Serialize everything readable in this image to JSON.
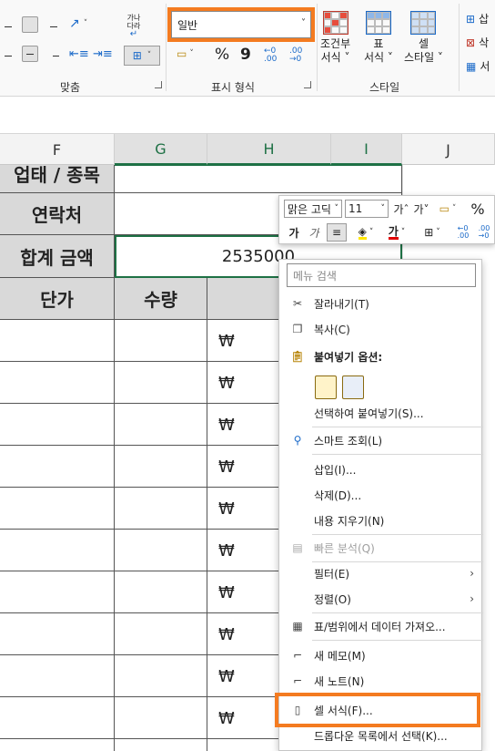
{
  "ribbon": {
    "wrap_text_label": "가나\n다라",
    "number_format": "일반",
    "groups": {
      "alignment": "맞춤",
      "number": "표시 형식",
      "styles": "스타일"
    },
    "percent": "%",
    "comma": "9",
    "inc_decimal": ".00→.0",
    "dec_decimal": ".00→.0",
    "styles_buttons": [
      {
        "line1": "조건부",
        "line2": "서식 ˅"
      },
      {
        "line1": "표",
        "line2": "서식 ˅"
      },
      {
        "line1": "셀",
        "line2": "스타일 ˅"
      }
    ],
    "cells_partial": [
      "삽",
      "삭",
      "서"
    ]
  },
  "columns": [
    "F",
    "G",
    "H",
    "I",
    "J"
  ],
  "sheet": {
    "row1_label": "업태 / 종목",
    "row2_label": "연락처",
    "row3_label": "합계 금액",
    "total_value": "2535000",
    "header_unit_price": "단가",
    "header_qty": "수량",
    "won_symbol": "₩"
  },
  "mini_toolbar": {
    "font_name": "맑은 고딕",
    "font_size": "11",
    "grow_font": "가ˆ",
    "shrink_font": "가˅",
    "percent": "%",
    "bold": "가",
    "italic": "가",
    "font_color_glyph": "가"
  },
  "context_menu": {
    "search_placeholder": "메뉴 검색",
    "items": {
      "cut": "잘라내기(T)",
      "copy": "복사(C)",
      "paste_options": "붙여넣기 옵션:",
      "paste_special": "선택하여 붙여넣기(S)...",
      "smart_lookup": "스마트 조회(L)",
      "insert": "삽입(I)...",
      "delete": "삭제(D)...",
      "clear_contents": "내용 지우기(N)",
      "quick_analysis": "빠른 분석(Q)",
      "filter": "필터(E)",
      "sort": "정렬(O)",
      "get_data": "표/범위에서 데이터 가져오...",
      "new_comment": "새 메모(M)",
      "new_note": "새 노트(N)",
      "format_cells": "셀 서식(F)...",
      "pick_list": "드롭다운 목록에서 선택(K)..."
    }
  },
  "colors": {
    "highlight": "#f47b20",
    "selection_green": "#1e7145",
    "gray_cell": "#d9d9d9"
  }
}
